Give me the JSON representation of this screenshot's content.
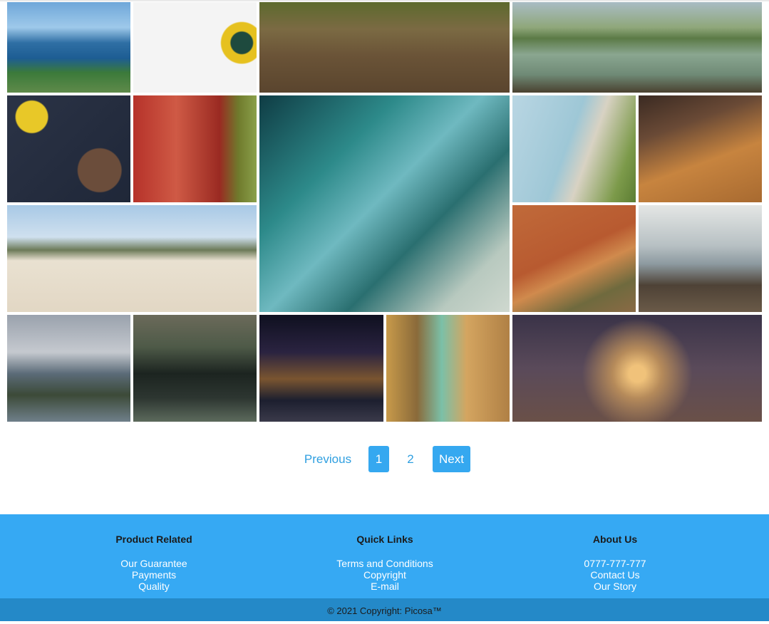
{
  "gallery": {
    "images": [
      {
        "name": "coastal-cliffs-photo",
        "bg": "linear-gradient(180deg,#6fa7d9 0%,#9ec9ea 28%,#2f6fa4 45%,#1d5d93 62%,#3b7a3a 78%,#5f8a4a 100%)"
      },
      {
        "name": "daisy-photo",
        "bg": "radial-gradient(circle at 88% 45%,#1e4a3e 0 9%,#e6c11f 10% 17%,#f4f4f4 18% 100%)"
      },
      {
        "name": "winding-path-photo",
        "bg": "linear-gradient(180deg,#5d6a2e 0%,#7b6a43 30%,#6a5337 60%,#5a452e 100%)"
      },
      {
        "name": "misty-lake-photo",
        "bg": "linear-gradient(180deg,#a9bcc4 0%,#8fa77a 28%,#5b7a46 40%,#8aa690 58%,#6f8a76 80%,#4a4130 100%)"
      },
      {
        "name": "daffodils-cookies-photo",
        "bg": "radial-gradient(circle at 75% 70%,#6b4d3b 0 18%,transparent 19%),radial-gradient(circle at 20% 20%,#e8c828 0 12%,transparent 13%),linear-gradient(135deg,#2b3346,#1f2738)"
      },
      {
        "name": "rusty-barrel-photo",
        "bg": "linear-gradient(90deg,#b6322a 0%,#cf5a45 35%,#9a2a22 70%,#6f7a2c 85%,#8aa04a 100%)"
      },
      {
        "name": "ocean-wave-photo",
        "bg": "linear-gradient(135deg,#0f3c44 0%,#2d8a8a 30%,#6fb9c0 48%,#2a6f70 65%,#b8c9bf 85%,#cfd8cf 100%)"
      },
      {
        "name": "lighthouse-cliff-photo",
        "bg": "linear-gradient(110deg,#b9d6e3 0%,#9ec7d6 45%,#d8d2c3 60%,#7c9a4a 85%,#5c7d33 100%)"
      },
      {
        "name": "notebook-desk-photo",
        "bg": "linear-gradient(160deg,#3a2a22 0%,#6a4a36 30%,#c7843f 60%,#a86a30 100%)"
      },
      {
        "name": "palm-beach-photo",
        "bg": "linear-gradient(180deg,#a8c9e6 0%,#cfe0ee 30%,#6c7a58 42%,#e9e1d1 52%,#e2d7c4 100%)"
      },
      {
        "name": "red-dune-photo",
        "bg": "linear-gradient(155deg,#c06a3a 0%,#b85a30 45%,#d08a4d 60%,#6f6a3e 80%,#8a6a45 100%)"
      },
      {
        "name": "rocky-shore-photo",
        "bg": "linear-gradient(180deg,#e4e6e5 0%,#b7c0c3 38%,#8d9aa0 55%,#4e4236 75%,#6a5a48 100%)"
      },
      {
        "name": "cloudy-bay-photo",
        "bg": "linear-gradient(180deg,#9aa2ad 0%,#c5c9cf 35%,#5b6b78 55%,#3c4a38 75%,#6f7f8a 100%)"
      },
      {
        "name": "frosty-shore-photo",
        "bg": "linear-gradient(180deg,#6b6a5a 0%,#4e5a48 30%,#1c2420 55%,#2d3631 78%,#5c6a5c 100%)"
      },
      {
        "name": "night-street-photo",
        "bg": "linear-gradient(180deg,#0f1020 0%,#2a2340 35%,#7a5530 60%,#1c1f2f 80%,#3a3a4a 100%)"
      },
      {
        "name": "glass-bottles-fence-photo",
        "bg": "linear-gradient(90deg,#c89a4a 0%,#8a6a3a 25%,#7bc0a8 45%,#d4a560 65%,#b08045 100%)"
      },
      {
        "name": "foggy-railway-photo",
        "bg": "radial-gradient(circle at 50% 55%,#f0c27a 0 6%,#b58a5a 18%,transparent 40%),linear-gradient(180deg,#3a3348 0%,#5a4a5a 50%,#6a5048 100%)"
      }
    ]
  },
  "pagination": {
    "previous_label": "Previous",
    "page1_label": "1",
    "page2_label": "2",
    "next_label": "Next",
    "accent_color": "#35a8f0"
  },
  "footer": {
    "bg_color": "#36a9f3",
    "product": {
      "title": "Product Related",
      "links": [
        "Our Guarantee",
        "Payments",
        "Quality"
      ]
    },
    "quick": {
      "title": "Quick Links",
      "links": [
        "Terms and Conditions",
        "Copyright",
        "E-mail"
      ]
    },
    "about": {
      "title": "About Us",
      "links": [
        "0777-777-777",
        "Contact Us",
        "Our Story"
      ]
    },
    "copyright": "© 2021 Copyright: Picosa™"
  }
}
